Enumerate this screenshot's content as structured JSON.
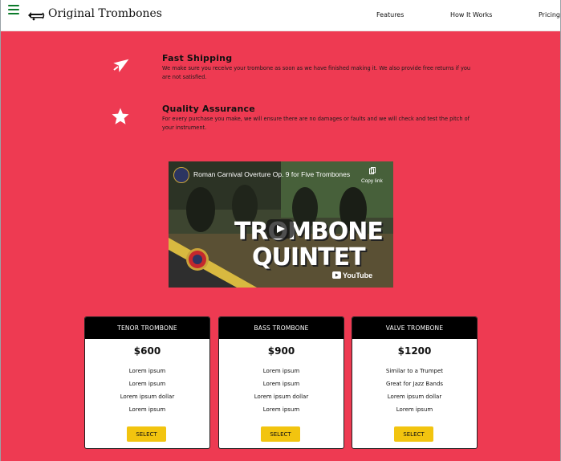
{
  "header": {
    "brand": "Original Trombones",
    "nav": [
      {
        "label": "Features"
      },
      {
        "label": "How It Works"
      },
      {
        "label": "Pricing"
      }
    ]
  },
  "features": [
    {
      "icon": "airplane-icon",
      "title": "Fast Shipping",
      "description": "We make sure you receive your trombone as soon as we have finished making it. We also provide free returns if you are not satisfied."
    },
    {
      "icon": "star-icon",
      "title": "Quality Assurance",
      "description": "For every purchase you make, we will ensure there are no damages or faults and we will check and test the pitch of your instrument."
    }
  ],
  "video": {
    "title": "Roman Carnival Overture Op. 9 for Five Trombones",
    "copy_label": "Copy link",
    "overlay_line1": "TROMBONE",
    "overlay_line2": "QUINTET",
    "youtube_label": "YouTube"
  },
  "pricing": [
    {
      "name": "TENOR TROMBONE",
      "price": "$600",
      "features": [
        "Lorem ipsum",
        "Lorem ipsum",
        "Lorem ipsum dollar",
        "Lorem ipsum"
      ],
      "button": "SELECT"
    },
    {
      "name": "BASS TROMBONE",
      "price": "$900",
      "features": [
        "Lorem ipsum",
        "Lorem ipsum",
        "Lorem ipsum dollar",
        "Lorem ipsum"
      ],
      "button": "SELECT"
    },
    {
      "name": "VALVE TROMBONE",
      "price": "$1200",
      "features": [
        "Similar to a Trumpet",
        "Great for Jazz Bands",
        "Lorem ipsum dollar",
        "Lorem ipsum"
      ],
      "button": "SELECT"
    }
  ],
  "colors": {
    "page_background": "#ee3a52",
    "header_background": "#ffffff",
    "card_header": "#000000",
    "button": "#f2c40f",
    "menu_icon": "#0b7a2a"
  }
}
